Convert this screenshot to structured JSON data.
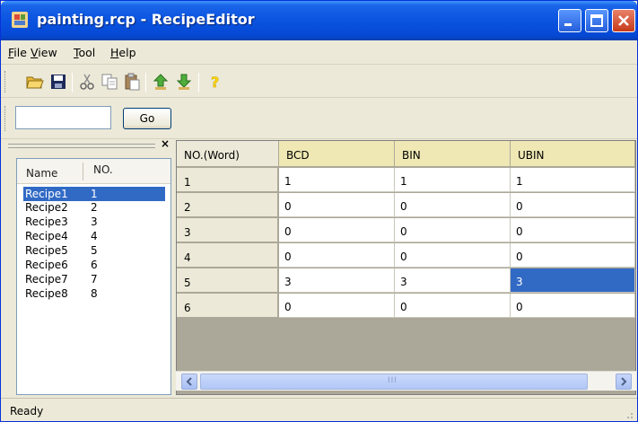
{
  "window": {
    "title": "painting.rcp - RecipeEditor"
  },
  "menu": [
    {
      "hotkey": "F",
      "rest": "ile"
    },
    {
      "hotkey": "V",
      "rest": "iew"
    },
    {
      "hotkey": "T",
      "rest": "ool"
    },
    {
      "hotkey": "H",
      "rest": "elp"
    }
  ],
  "toolbar": {
    "icons": [
      "open-folder-icon",
      "save-icon",
      "cut-icon",
      "copy-icon",
      "paste-icon",
      "upload-icon",
      "download-icon",
      "help-icon"
    ]
  },
  "search": {
    "value": "",
    "go_label": "Go"
  },
  "recipes": {
    "col_name": "Name",
    "col_no": "NO.",
    "close_glyph": "×",
    "items": [
      {
        "name": "Recipe1",
        "no": "1",
        "selected": true
      },
      {
        "name": "Recipe2",
        "no": "2"
      },
      {
        "name": "Recipe3",
        "no": "3"
      },
      {
        "name": "Recipe4",
        "no": "4"
      },
      {
        "name": "Recipe5",
        "no": "5"
      },
      {
        "name": "Recipe6",
        "no": "6"
      },
      {
        "name": "Recipe7",
        "no": "7"
      },
      {
        "name": "Recipe8",
        "no": "8"
      }
    ]
  },
  "grid": {
    "headers": [
      "NO.(Word)",
      "BCD",
      "BIN",
      "UBIN"
    ],
    "rows": [
      {
        "no": "1",
        "bcd": "1",
        "bin": "1",
        "ubin": "1"
      },
      {
        "no": "2",
        "bcd": "0",
        "bin": "0",
        "ubin": "0"
      },
      {
        "no": "3",
        "bcd": "0",
        "bin": "0",
        "ubin": "0"
      },
      {
        "no": "4",
        "bcd": "0",
        "bin": "0",
        "ubin": "0"
      },
      {
        "no": "5",
        "bcd": "3",
        "bin": "3",
        "ubin": "3"
      },
      {
        "no": "6",
        "bcd": "0",
        "bin": "0",
        "ubin": "0"
      }
    ],
    "scroll_center_glyph": "III"
  },
  "status": {
    "text": "Ready"
  },
  "colors": {
    "titlebar": "#0a54e0",
    "selection": "#316ac5",
    "active_header": "#efe8b4"
  }
}
